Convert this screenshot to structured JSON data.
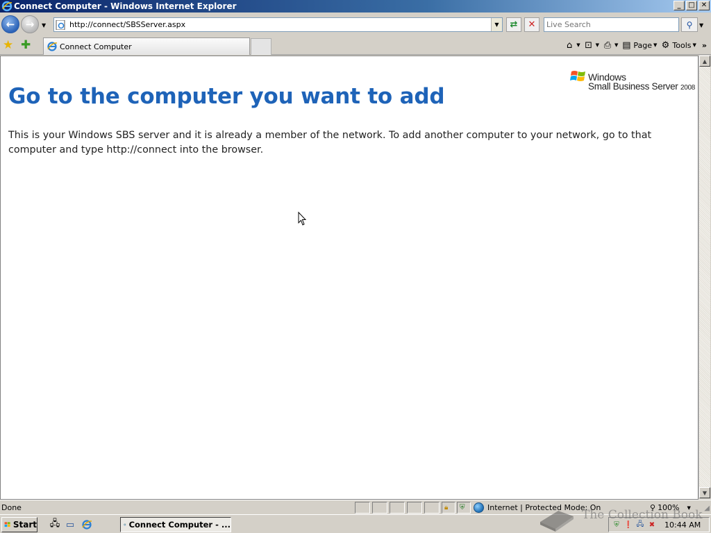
{
  "window": {
    "title": "Connect Computer - Windows Internet Explorer",
    "buttons": {
      "minimize": "_",
      "maximize": "□",
      "close": "✕"
    }
  },
  "address_bar": {
    "url": "http://connect/SBSServer.aspx",
    "search_placeholder": "Live Search"
  },
  "tabs": [
    {
      "label": "Connect Computer"
    }
  ],
  "command_bar": {
    "page_label": "Page",
    "tools_label": "Tools"
  },
  "page": {
    "logo_windows": "Windows",
    "logo_product": "Small Business Server",
    "logo_year": "2008",
    "heading": "Go to the computer you want to add",
    "body": "This is your Windows SBS server and it is already a member of the network. To add another computer to your network, go to that computer and type http://connect into the browser."
  },
  "status_bar": {
    "status": "Done",
    "zone": "Internet | Protected Mode: On",
    "zoom": "100%"
  },
  "taskbar": {
    "start_label": "Start",
    "task_item": "Connect Computer - ...",
    "clock": "10:44 AM"
  },
  "watermark": {
    "text": "The Collection Book"
  },
  "colors": {
    "heading": "#1e63b8",
    "titlebar_start": "#0a246a",
    "titlebar_end": "#a6caf0"
  }
}
